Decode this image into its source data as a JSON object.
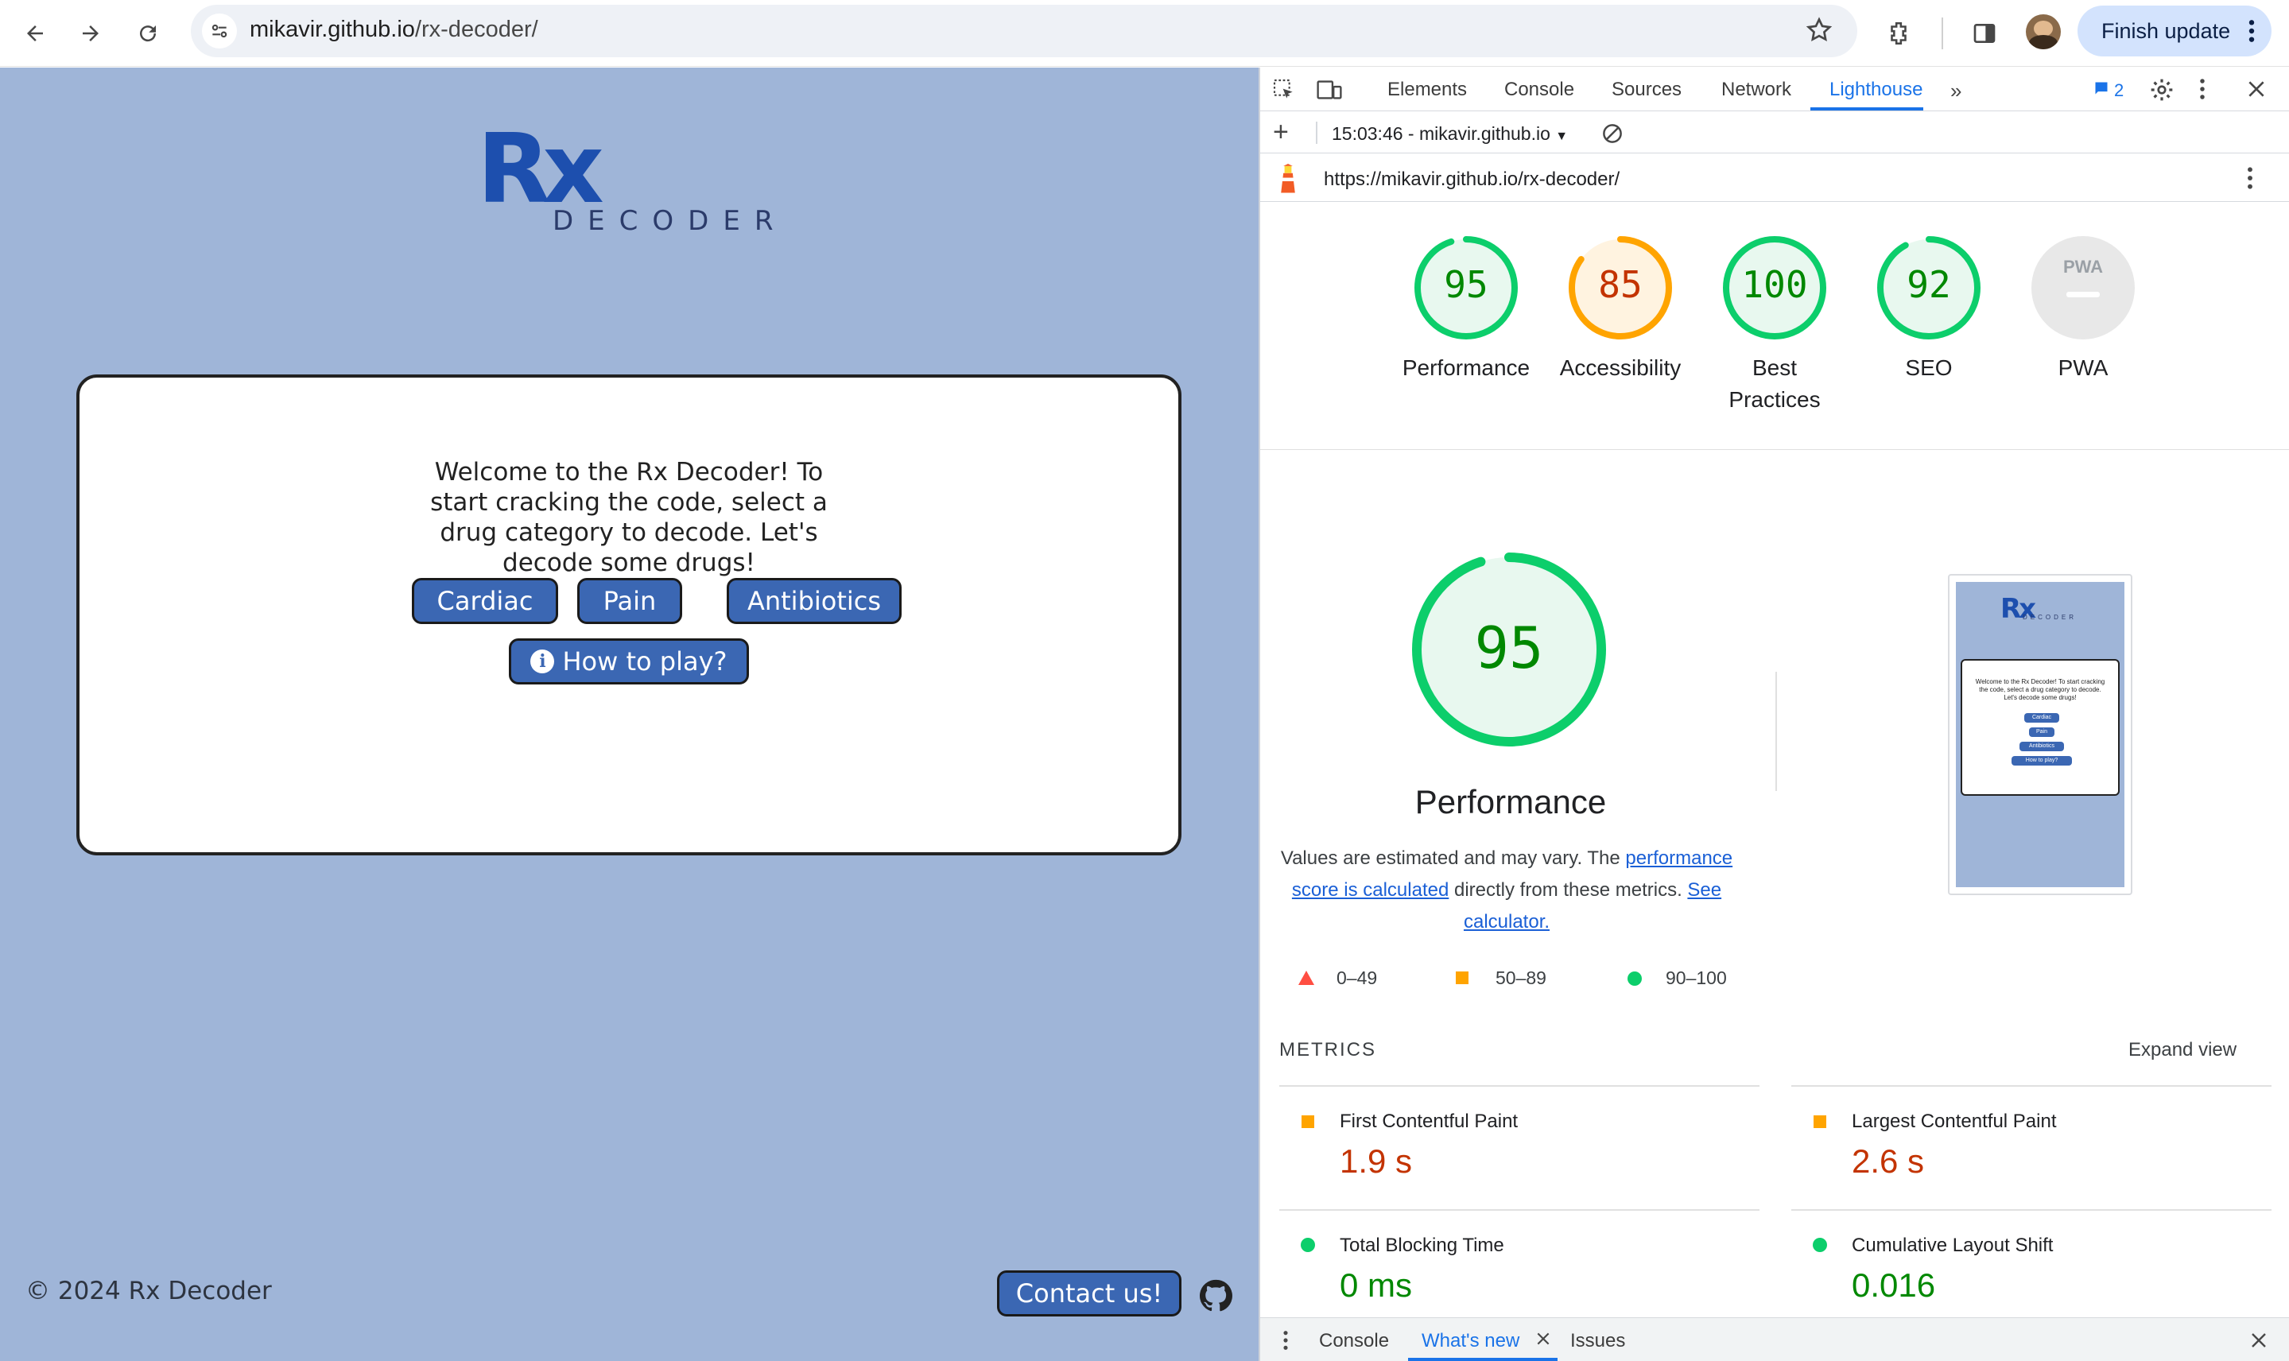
{
  "browser": {
    "url_host": "mikavir.github.io",
    "url_path": "/rx-decoder/",
    "finish_update_label": "Finish update"
  },
  "page": {
    "logo_rx": "Rx",
    "logo_decoder": "DECODER",
    "welcome_lines": [
      "Welcome to the Rx Decoder! To",
      "start cracking the code, select a",
      "drug category to decode. Let's",
      "decode some drugs!"
    ],
    "buttons": {
      "cardiac": "Cardiac",
      "pain": "Pain",
      "antibiotics": "Antibiotics",
      "how_to_play": "How to play?"
    },
    "copyright": "© 2024 Rx Decoder",
    "contact_label": "Contact us!"
  },
  "devtools": {
    "tabs": [
      "Elements",
      "Console",
      "Sources",
      "Network",
      "Lighthouse"
    ],
    "issues_count": "2",
    "report_selector": "15:03:46 - mikavir.github.io",
    "report_url": "https://mikavir.github.io/rx-decoder/",
    "scores": [
      {
        "value": "95",
        "label": "Performance",
        "score": 95,
        "color": "#0cce6b",
        "text_color": "#008800",
        "bg": "#e8f8ef"
      },
      {
        "value": "85",
        "label": "Accessibility",
        "score": 85,
        "color": "#ffa400",
        "text_color": "#c33300",
        "bg": "#fff3e0"
      },
      {
        "value": "100",
        "label_line1": "Best",
        "label_line2": "Practices",
        "score": 100,
        "color": "#0cce6b",
        "text_color": "#008800",
        "bg": "#e8f8ef"
      },
      {
        "value": "92",
        "label": "SEO",
        "score": 92,
        "color": "#0cce6b",
        "text_color": "#008800",
        "bg": "#e8f8ef"
      },
      {
        "label": "PWA",
        "badge": "PWA"
      }
    ],
    "big_score": "95",
    "big_label": "Performance",
    "desc_prefix": "Values are estimated and may vary. The ",
    "desc_link1": "performance score is calculated",
    "desc_mid": " directly from these metrics. ",
    "desc_link2": "See calculator.",
    "legend": [
      "0–49",
      "50–89",
      "90–100"
    ],
    "metrics_heading": "METRICS",
    "expand_view": "Expand view",
    "metrics": [
      {
        "label": "First Contentful Paint",
        "value": "1.9 s",
        "status": "average"
      },
      {
        "label": "Largest Contentful Paint",
        "value": "2.6 s",
        "status": "average"
      },
      {
        "label": "Total Blocking Time",
        "value": "0 ms",
        "status": "pass"
      },
      {
        "label": "Cumulative Layout Shift",
        "value": "0.016",
        "status": "pass"
      }
    ],
    "thumbnail": {
      "welcome": "Welcome to the Rx Decoder! To start cracking the code, select a drug category to decode. Let's decode some drugs!",
      "buttons": [
        "Cardiac",
        "Pain",
        "Antibiotics",
        "How to play?"
      ]
    },
    "bottom_tabs": [
      "Console",
      "What's new",
      "Issues"
    ]
  },
  "colors": {
    "page_bg": "#9fb5d8",
    "brand_blue": "#3b67b3",
    "logo_blue": "#1d4fae",
    "pass": "#0cce6b",
    "average": "#ffa400",
    "fail": "#ff4e42"
  }
}
